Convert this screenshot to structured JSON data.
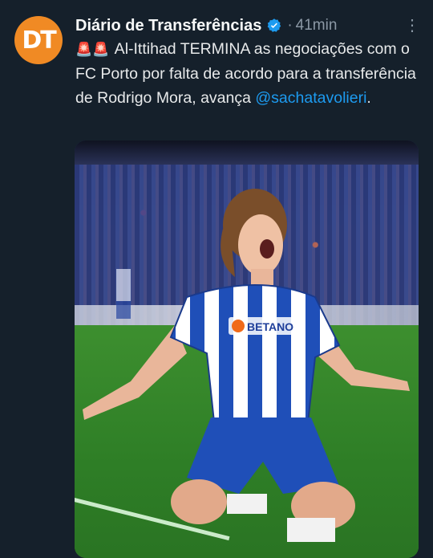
{
  "avatar": {
    "initials": "DT",
    "color": "#f08a24"
  },
  "tweet": {
    "author": "Diário de Transferências",
    "verified_icon": "verified-badge-icon",
    "separator": "·",
    "time": "41min",
    "more_icon": "more-options-icon",
    "sirens": "🚨🚨",
    "text": " Al-Ittihad TERMINA as negociações com o FC Porto por falta de acordo para a transferência de Rodrigo Mora, avança ",
    "mention": "@sachatavolieri",
    "text_end": "."
  },
  "media": {
    "sponsor": "BETANO",
    "jersey_colors": [
      "#1f4fb8",
      "#ffffff"
    ],
    "pitch_color": "#2f7a28"
  },
  "colors": {
    "background": "#15202b",
    "link": "#1d9bf0",
    "secondary_text": "#8b98a5",
    "verified": "#1d9bf0"
  }
}
